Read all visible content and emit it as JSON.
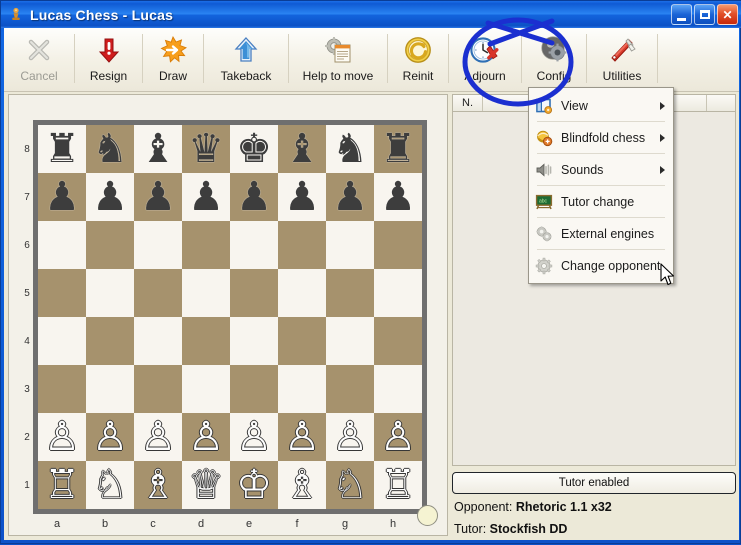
{
  "window": {
    "title": "Lucas Chess - Lucas",
    "icon": "chess-pawn-icon",
    "controls": {
      "minimize": "_",
      "maximize": "□",
      "close": "✕"
    }
  },
  "toolbar": {
    "buttons": [
      {
        "label": "Cancel",
        "icon": "cancel-x-icon",
        "disabled": true
      },
      {
        "label": "Resign",
        "icon": "red-down-arrow-icon",
        "disabled": false
      },
      {
        "label": "Draw",
        "icon": "orange-star-icon",
        "disabled": false
      },
      {
        "label": "Takeback",
        "icon": "blue-up-arrow-icon",
        "disabled": false
      },
      {
        "label": "Help to move",
        "icon": "gear-document-icon",
        "disabled": false
      },
      {
        "label": "Reinit",
        "icon": "yellow-refresh-icon",
        "disabled": false
      },
      {
        "label": "Adjourn",
        "icon": "clock-icon",
        "disabled": false
      },
      {
        "label": "Config",
        "icon": "gear-eye-icon",
        "disabled": false
      },
      {
        "label": "Utilities",
        "icon": "swiss-knife-icon",
        "disabled": false
      }
    ]
  },
  "menu": {
    "items": [
      {
        "label": "View",
        "icon": "window-view-icon",
        "submenu": true
      },
      {
        "label": "Blindfold chess",
        "icon": "blindfold-icon",
        "submenu": true
      },
      {
        "label": "Sounds",
        "icon": "speaker-icon",
        "submenu": true
      },
      {
        "label": "Tutor change",
        "icon": "blackboard-icon",
        "submenu": false
      },
      {
        "label": "External engines",
        "icon": "gears-grey-icon",
        "submenu": false
      },
      {
        "label": "Change opponent",
        "icon": "gear-grey-icon",
        "submenu": false
      }
    ]
  },
  "board": {
    "ranks": [
      "8",
      "7",
      "6",
      "5",
      "4",
      "3",
      "2",
      "1"
    ],
    "files": [
      "a",
      "b",
      "c",
      "d",
      "e",
      "f",
      "g",
      "h"
    ],
    "turn_indicator": "white-to-move",
    "light_color": "#f8f5ef",
    "dark_color": "#a6926d",
    "position": [
      [
        "r",
        "n",
        "b",
        "q",
        "k",
        "b",
        "n",
        "r"
      ],
      [
        "p",
        "p",
        "p",
        "p",
        "p",
        "p",
        "p",
        "p"
      ],
      [
        "",
        "",
        "",
        "",
        "",
        "",
        "",
        ""
      ],
      [
        "",
        "",
        "",
        "",
        "",
        "",
        "",
        ""
      ],
      [
        "",
        "",
        "",
        "",
        "",
        "",
        "",
        ""
      ],
      [
        "",
        "",
        "",
        "",
        "",
        "",
        "",
        ""
      ],
      [
        "P",
        "P",
        "P",
        "P",
        "P",
        "P",
        "P",
        "P"
      ],
      [
        "R",
        "N",
        "B",
        "Q",
        "K",
        "B",
        "N",
        "R"
      ]
    ]
  },
  "movelist": {
    "columns": [
      "N.",
      "",
      "",
      ""
    ],
    "rows": []
  },
  "status": {
    "tutor_button": "Tutor enabled",
    "opponent_label": "Opponent:",
    "opponent_value": "Rhetoric 1.1 x32",
    "tutor_label": "Tutor:",
    "tutor_value": "Stockfish DD"
  },
  "annotation": {
    "highlight_target": "Config",
    "color": "#1b2fd0",
    "shape": "ellipse-with-cross"
  }
}
